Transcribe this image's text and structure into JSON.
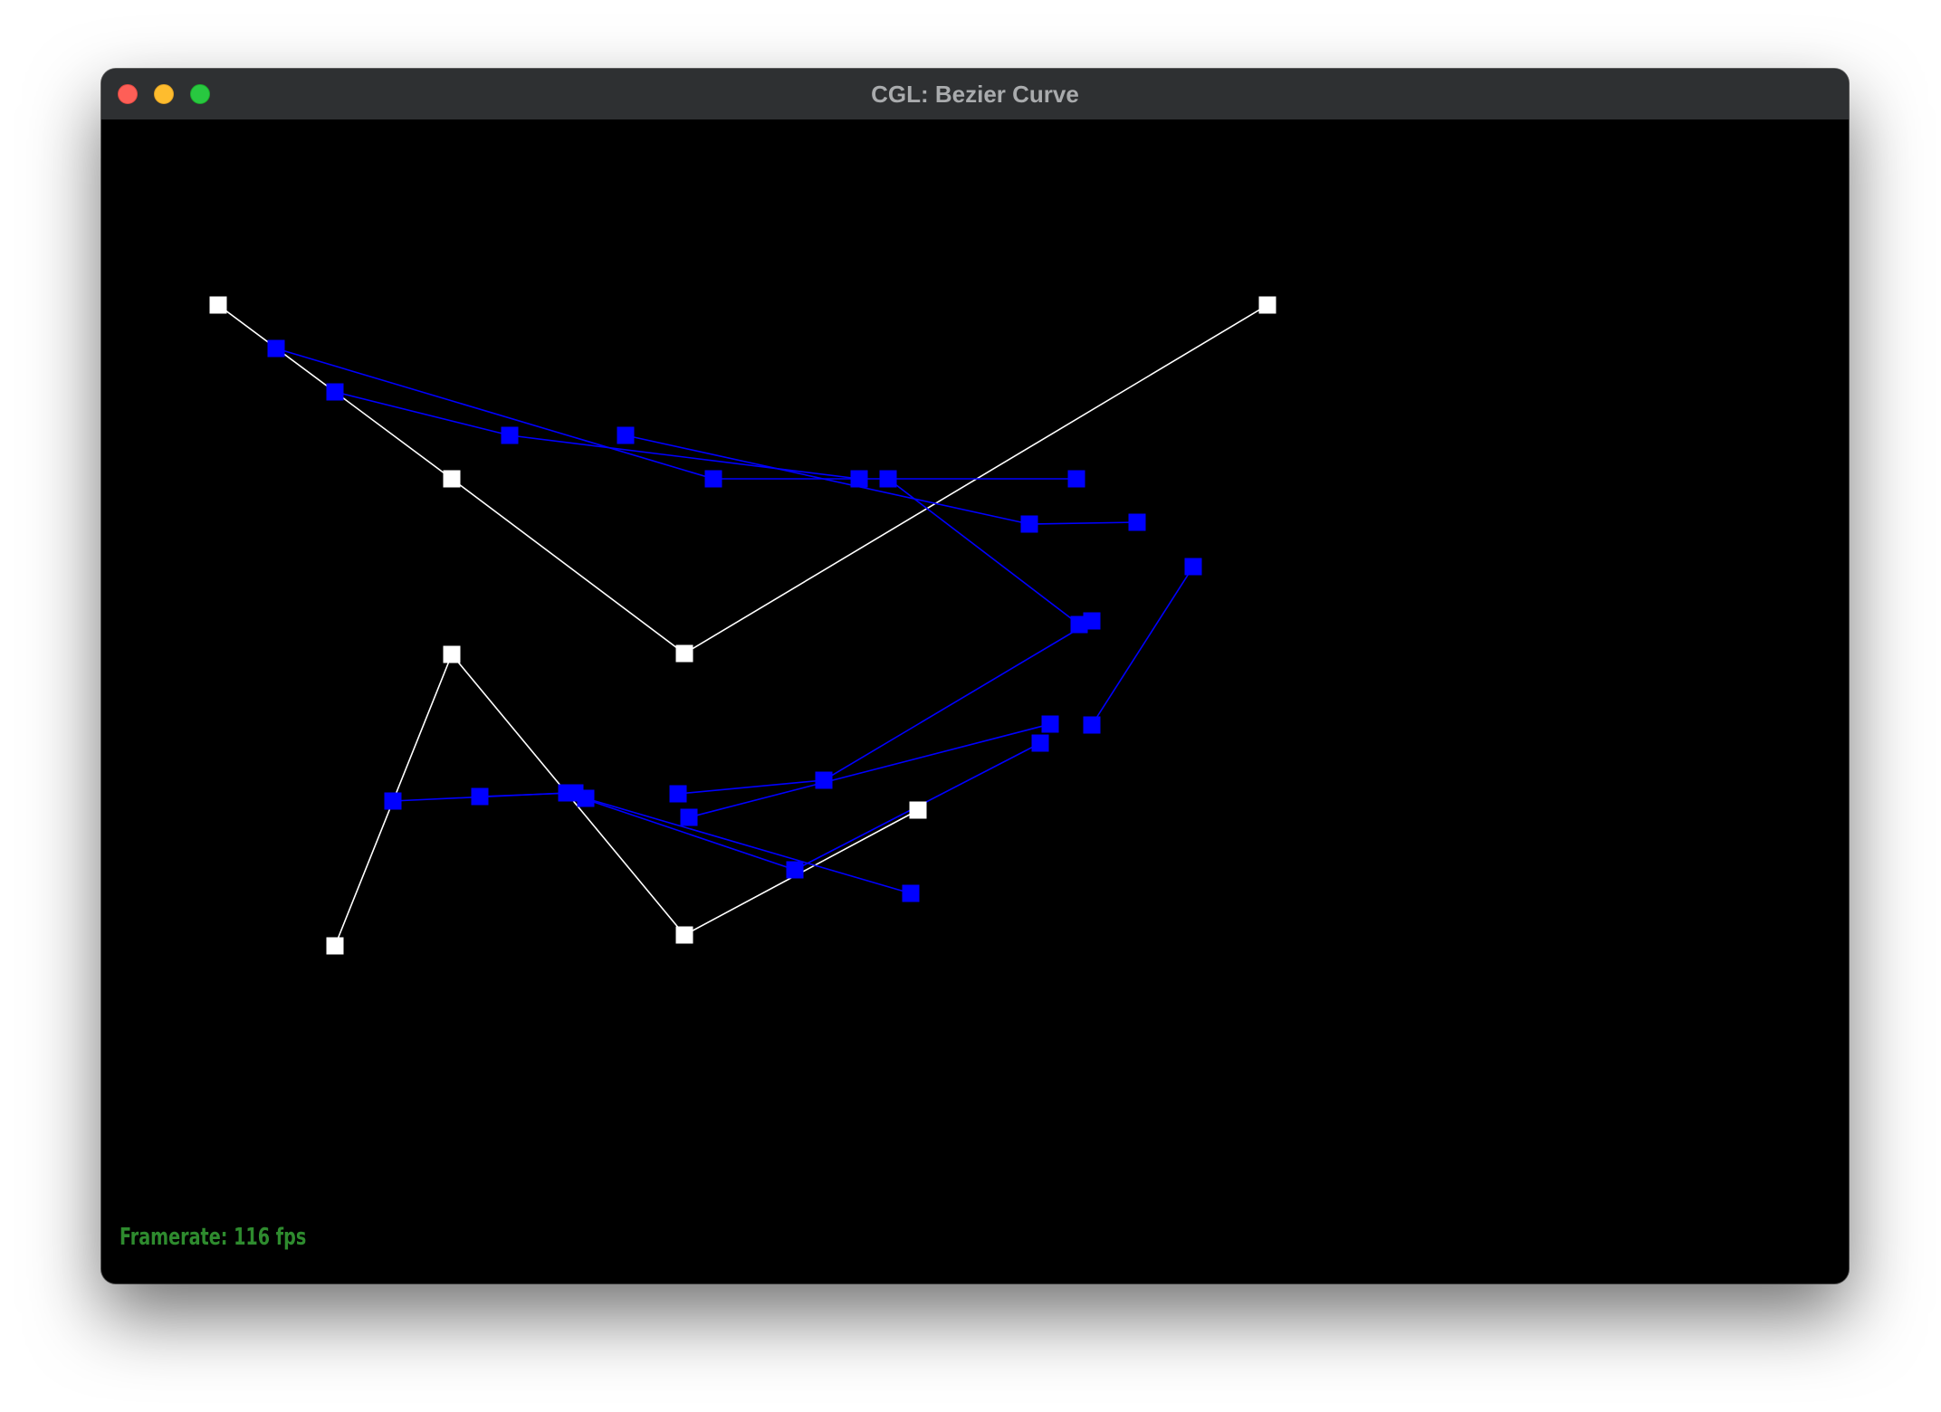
{
  "window": {
    "title": "CGL: Bezier Curve"
  },
  "overlay": {
    "framerate_text": "Framerate: 116 fps"
  },
  "colors": {
    "control_polygon": "#ffffff",
    "subdivision_levels": "#0000ff",
    "framerate_text": "#2e8b2e",
    "background": "#000000"
  }
}
